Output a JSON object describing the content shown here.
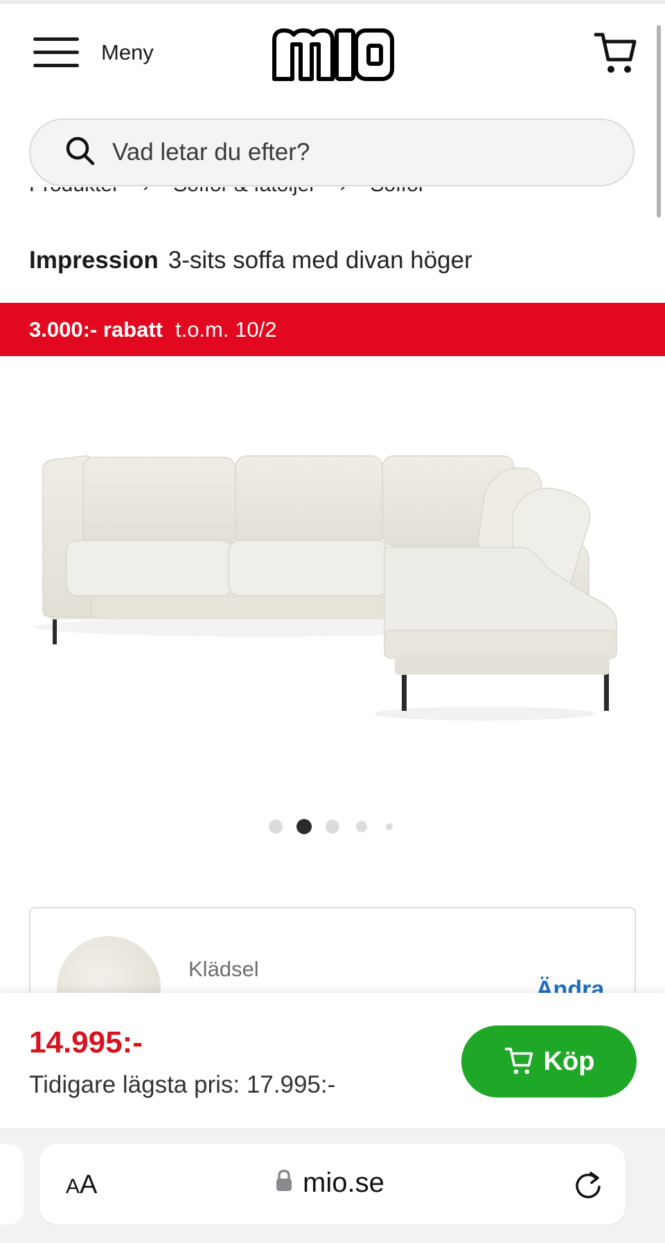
{
  "header": {
    "menu_label": "Meny",
    "logo_text": "mio"
  },
  "search": {
    "placeholder": "Vad letar du efter?"
  },
  "breadcrumb": [
    "Produkter",
    "Soffor & fåtöljer",
    "Soffor"
  ],
  "product": {
    "brand": "Impression",
    "description": "3-sits soffa med divan höger"
  },
  "promo": {
    "amount": "3.000:- rabatt",
    "date": "t.o.m. 10/2"
  },
  "carousel": {
    "count": 5,
    "active_index": 1
  },
  "option": {
    "label": "Klädsel",
    "action": "Ändra"
  },
  "buy_bar": {
    "price": "14.995:-",
    "previous_price": "Tidigare lägsta pris: 17.995:-",
    "buy_label": "Köp"
  },
  "browser": {
    "text_size_label_small": "A",
    "text_size_label_large": "A",
    "url": "mio.se"
  },
  "colors": {
    "promo": "#e1081f",
    "price": "#d7141f",
    "buy": "#1fa728",
    "link": "#1e6fc0"
  }
}
